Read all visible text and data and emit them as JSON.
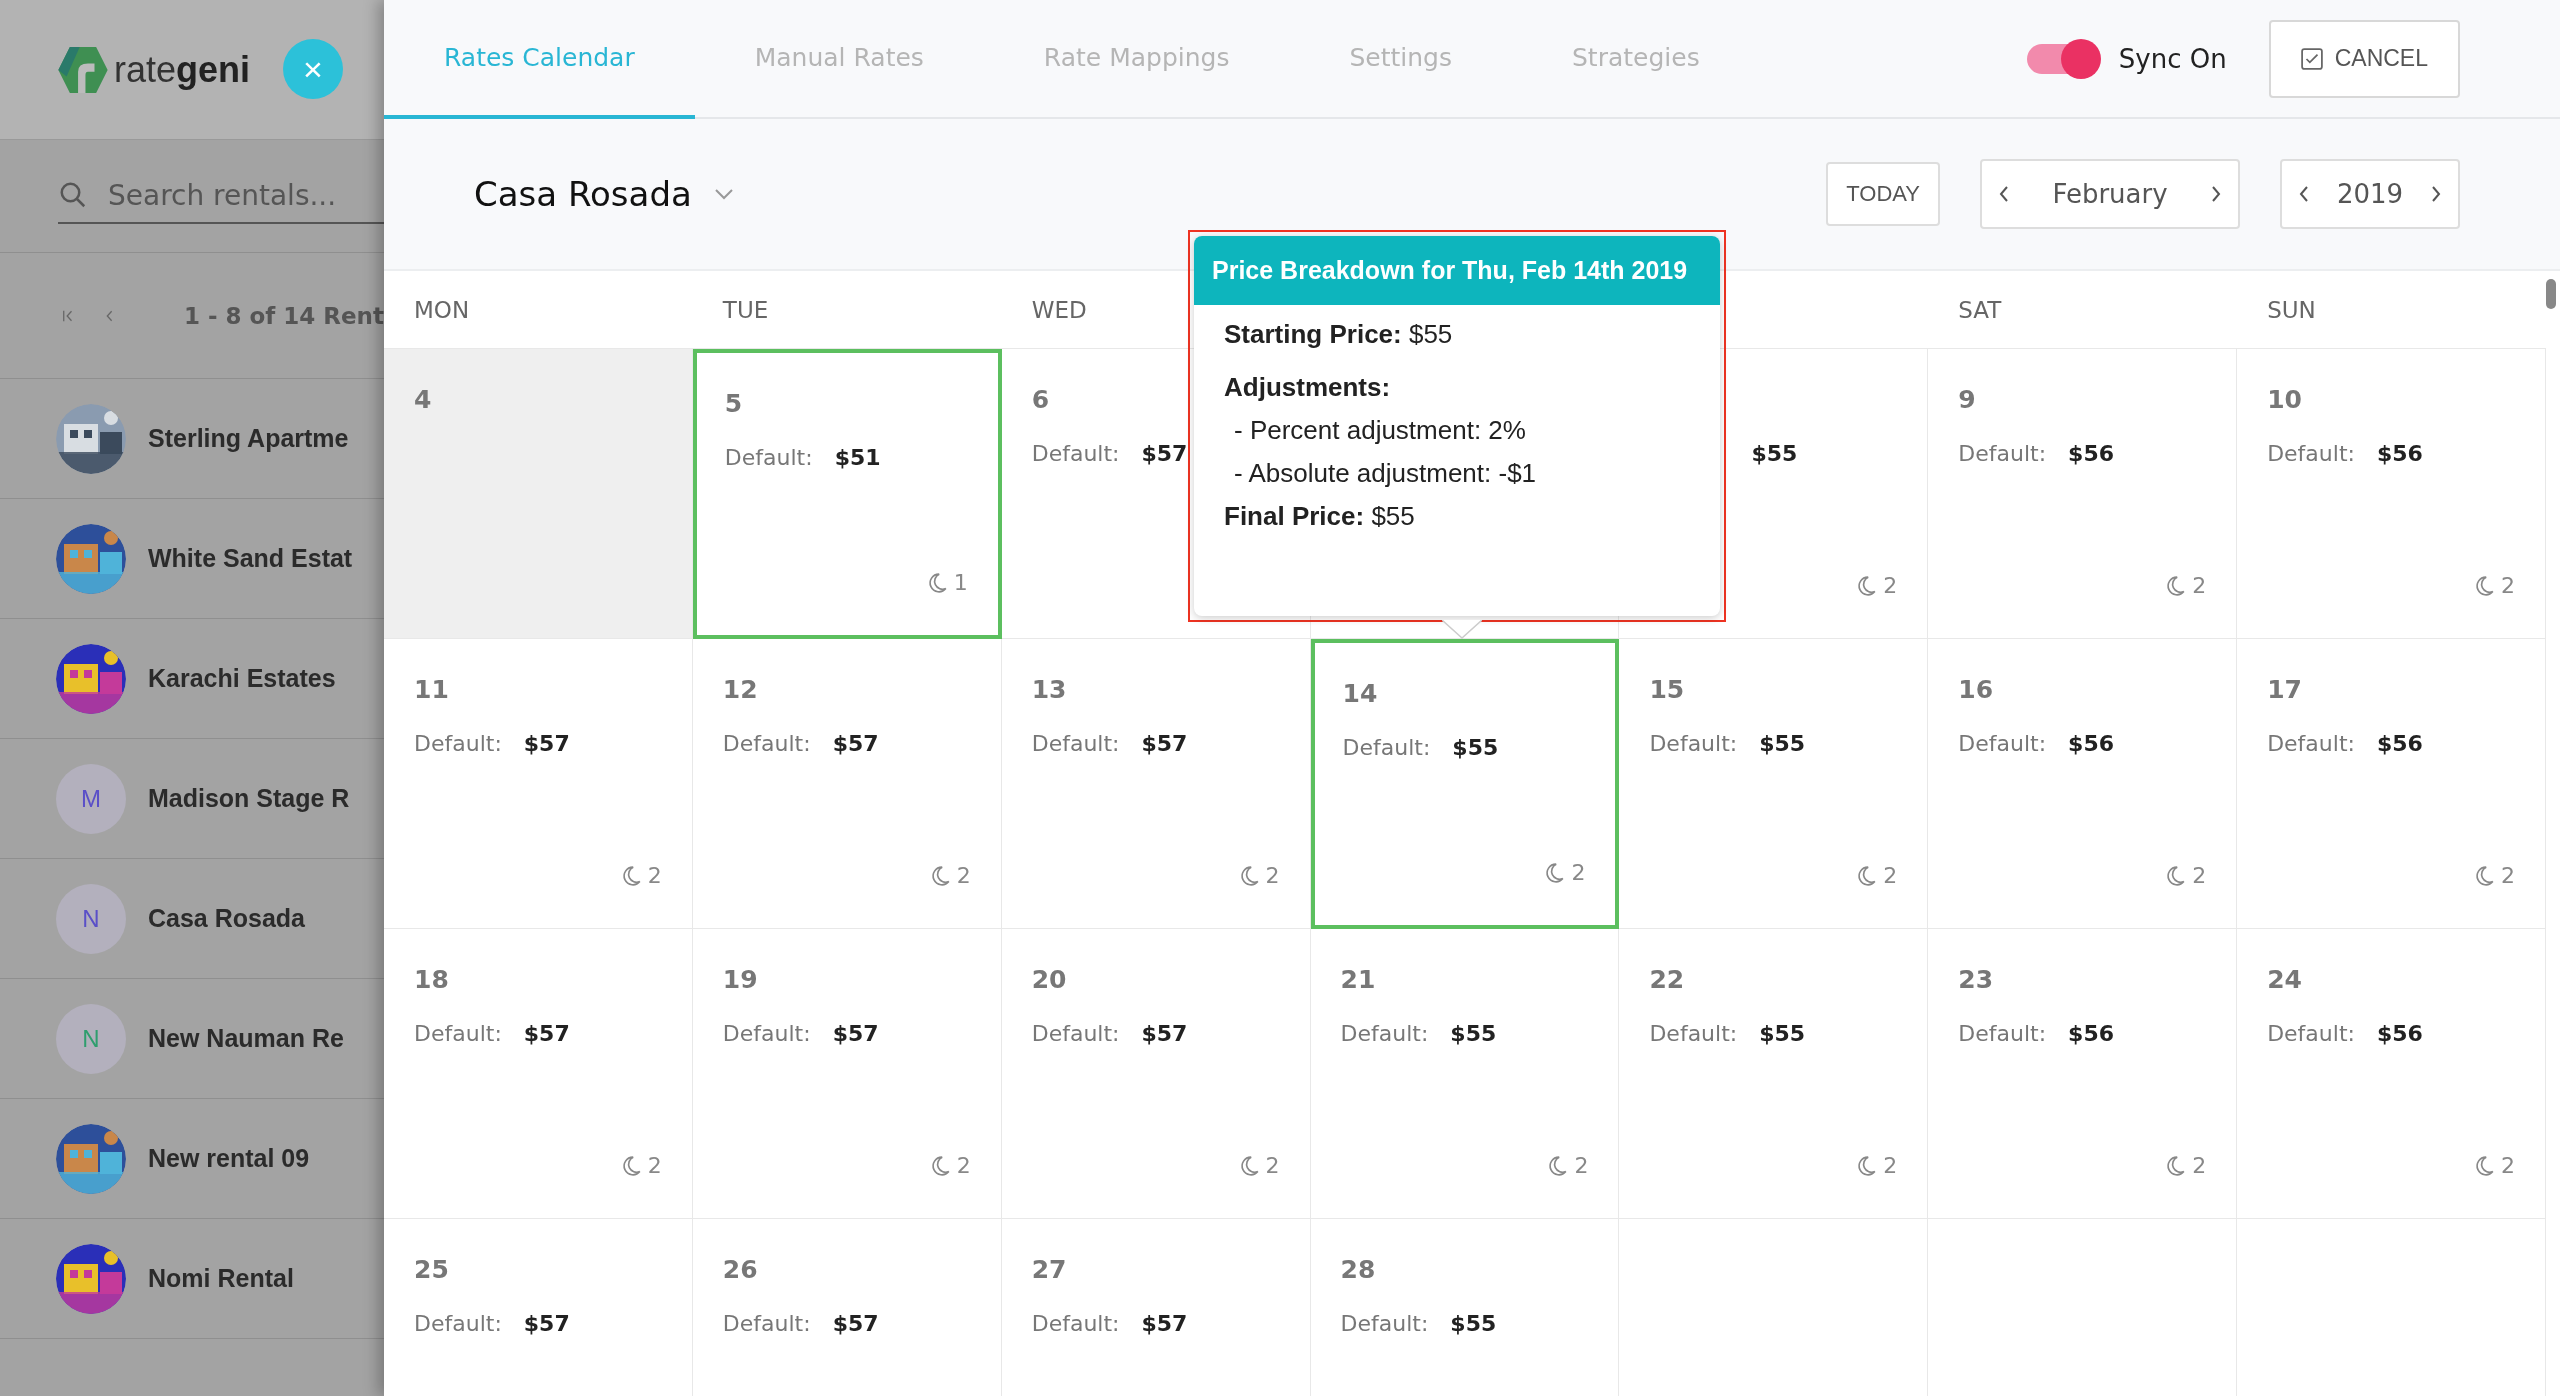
{
  "sidebar": {
    "logo": "rate**geni**",
    "close": "×",
    "search": {
      "placeholder": "Search rentals..."
    },
    "pager": "1 - 8 of 14 Rent",
    "rentals": [
      {
        "name": "Sterling Apartme"
      },
      {
        "name": "White Sand Estat"
      },
      {
        "name": "Karachi Estates"
      },
      {
        "name": "Madison Stage R",
        "avatar": {
          "kind": "letter",
          "letter": "M",
          "color": "#5a4fc8"
        }
      },
      {
        "name": "Casa Rosada",
        "avatar": {
          "kind": "letter",
          "letter": "N",
          "color": "#5a4fc8"
        }
      },
      {
        "name": "New Nauman Re",
        "avatar": {
          "kind": "letter",
          "letter": "N",
          "color": "#2f9e6e"
        }
      },
      {
        "name": "New rental 09"
      },
      {
        "name": "Nomi Rental"
      }
    ]
  },
  "tabs": [
    {
      "label": "Rates Calendar",
      "selected": true
    },
    {
      "label": "Manual Rates",
      "selected": false
    },
    {
      "label": "Rate Mappings",
      "selected": false
    },
    {
      "label": "Settings",
      "selected": false
    },
    {
      "label": "Strategies",
      "selected": false
    }
  ],
  "sync": {
    "label": "Sync On",
    "on": true
  },
  "cancel": "CANCEL",
  "property": "Casa Rosada",
  "today": "TODAY",
  "month": "February",
  "year": "2019",
  "weekdays": [
    {
      "label": "MON"
    },
    {
      "label": "TUE"
    },
    {
      "label": "WED"
    },
    {
      "label": "SAT"
    },
    {
      "label": "SUN"
    }
  ],
  "weeks": [
    [
      {
        "kind": "day",
        "day": "4",
        "past": true,
        "selected": false
      },
      {
        "kind": "day",
        "day": "5",
        "label": "Default:",
        "price": "$51",
        "nights": "1",
        "past": false,
        "selected": true
      },
      {
        "kind": "day",
        "day": "6",
        "label": "Default:",
        "price": "$57",
        "past": false,
        "selected": false
      },
      {
        "kind": "day",
        "past": false,
        "selected": false
      },
      {
        "kind": "day",
        "price": "$55",
        "nights": "2",
        "past": false,
        "selected": false
      },
      {
        "kind": "day",
        "day": "9",
        "label": "Default:",
        "price": "$56",
        "nights": "2",
        "past": false,
        "selected": false
      },
      {
        "kind": "day",
        "day": "10",
        "label": "Default:",
        "price": "$56",
        "nights": "2",
        "past": false,
        "selected": false
      }
    ],
    [
      {
        "kind": "day",
        "day": "11",
        "label": "Default:",
        "price": "$57",
        "nights": "2",
        "past": false,
        "selected": false
      },
      {
        "kind": "day",
        "day": "12",
        "label": "Default:",
        "price": "$57",
        "nights": "2",
        "past": false,
        "selected": false
      },
      {
        "kind": "day",
        "day": "13",
        "label": "Default:",
        "price": "$57",
        "nights": "2",
        "past": false,
        "selected": false
      },
      {
        "kind": "day",
        "day": "14",
        "label": "Default:",
        "price": "$55",
        "nights": "2",
        "past": false,
        "selected": true
      },
      {
        "kind": "day",
        "day": "15",
        "label": "Default:",
        "price": "$55",
        "nights": "2",
        "past": false,
        "selected": false
      },
      {
        "kind": "day",
        "day": "16",
        "label": "Default:",
        "price": "$56",
        "nights": "2",
        "past": false,
        "selected": false
      },
      {
        "kind": "day",
        "day": "17",
        "label": "Default:",
        "price": "$56",
        "nights": "2",
        "past": false,
        "selected": false
      }
    ],
    [
      {
        "kind": "day",
        "day": "18",
        "label": "Default:",
        "price": "$57",
        "nights": "2",
        "past": false,
        "selected": false
      },
      {
        "kind": "day",
        "day": "19",
        "label": "Default:",
        "price": "$57",
        "nights": "2",
        "past": false,
        "selected": false
      },
      {
        "kind": "day",
        "day": "20",
        "label": "Default:",
        "price": "$57",
        "nights": "2",
        "past": false,
        "selected": false
      },
      {
        "kind": "day",
        "day": "21",
        "label": "Default:",
        "price": "$55",
        "nights": "2",
        "past": false,
        "selected": false
      },
      {
        "kind": "day",
        "day": "22",
        "label": "Default:",
        "price": "$55",
        "nights": "2",
        "past": false,
        "selected": false
      },
      {
        "kind": "day",
        "day": "23",
        "label": "Default:",
        "price": "$56",
        "nights": "2",
        "past": false,
        "selected": false
      },
      {
        "kind": "day",
        "day": "24",
        "label": "Default:",
        "price": "$56",
        "nights": "2",
        "past": false,
        "selected": false
      }
    ],
    [
      {
        "kind": "day",
        "day": "25",
        "label": "Default:",
        "price": "$57",
        "past": false,
        "selected": false
      },
      {
        "kind": "day",
        "day": "26",
        "label": "Default:",
        "price": "$57",
        "past": false,
        "selected": false
      },
      {
        "kind": "day",
        "day": "27",
        "label": "Default:",
        "price": "$57",
        "past": false,
        "selected": false
      },
      {
        "kind": "day",
        "day": "28",
        "label": "Default:",
        "price": "$55",
        "past": false,
        "selected": false
      },
      {
        "kind": "blank",
        "selected": false
      },
      {
        "kind": "blank",
        "selected": false
      },
      {
        "kind": "blank",
        "selected": false
      }
    ]
  ],
  "tooltip": {
    "title": "Price Breakdown for Thu, Feb 14th 2019",
    "lines": [
      {
        "kind": "field",
        "text": "**Starting Price:** $55"
      },
      {
        "kind": "heading",
        "text": "Adjustments:"
      },
      {
        "kind": "item",
        "text": "- Percent adjustment: 2%"
      },
      {
        "kind": "item",
        "text": "- Absolute adjustment: -$1"
      },
      {
        "kind": "field",
        "text": "**Final Price:** $55"
      }
    ]
  }
}
